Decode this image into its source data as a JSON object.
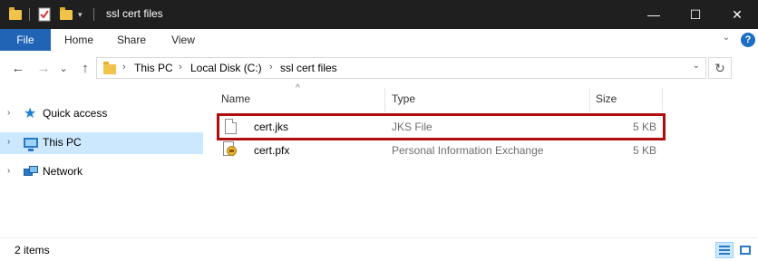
{
  "window": {
    "title": "ssl cert files",
    "controls": {
      "minimize": "—",
      "maximize": "☐",
      "close": "✕"
    }
  },
  "quick_access_toolbar": {
    "icons": [
      "folder-icon",
      "properties-icon",
      "new-folder-icon",
      "customize-dropdown-icon"
    ]
  },
  "ribbon": {
    "tabs": [
      {
        "label": "File",
        "active": true
      },
      {
        "label": "Home"
      },
      {
        "label": "Share"
      },
      {
        "label": "View"
      }
    ],
    "expand_icon": "chevron-down-icon",
    "help_label": "?"
  },
  "navigation": {
    "back_icon": "←",
    "forward_icon": "→",
    "recent_icon": "⌄",
    "up_icon": "↑",
    "breadcrumb": [
      "This PC",
      "Local Disk (C:)",
      "ssl cert files"
    ],
    "breadcrumb_separator": "›",
    "address_dropdown_icon": "⌄",
    "refresh_icon": "↻"
  },
  "sidebar": {
    "items": [
      {
        "label": "Quick access",
        "icon": "star-icon",
        "expand": "›"
      },
      {
        "label": "This PC",
        "icon": "computer-icon",
        "expand": "›",
        "selected": true
      },
      {
        "label": "Network",
        "icon": "network-icon",
        "expand": "›"
      }
    ]
  },
  "file_list": {
    "sort_indicator": "^",
    "columns": [
      "Name",
      "Type",
      "Size"
    ],
    "rows": [
      {
        "name": "cert.jks",
        "type": "JKS File",
        "size": "5 KB",
        "icon": "blank-file-icon",
        "highlighted": true
      },
      {
        "name": "cert.pfx",
        "type": "Personal Information Exchange",
        "size": "5 KB",
        "icon": "certificate-file-icon"
      }
    ],
    "highlight_color": "#b00d10"
  },
  "status_bar": {
    "item_count": "2 items"
  },
  "colors": {
    "titlebar_bg": "#1f1f1f",
    "file_tab_bg": "#2164b6",
    "selection_bg": "#cce8ff",
    "folder_yellow": "#f1c34a"
  }
}
